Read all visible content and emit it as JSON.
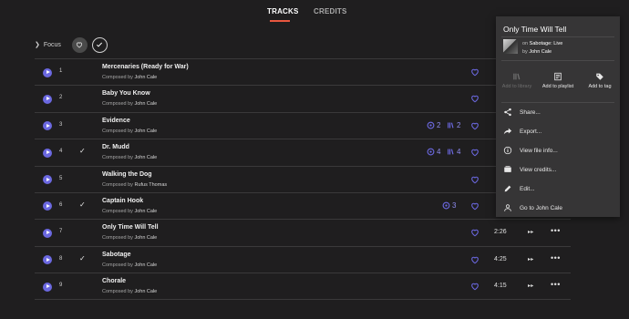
{
  "tabs": [
    {
      "label": "TRACKS",
      "active": true
    },
    {
      "label": "CREDITS",
      "active": false
    }
  ],
  "filters": {
    "focus_label": "Focus"
  },
  "tracks": [
    {
      "number": "1",
      "title": "Mercenaries (Ready for War)",
      "composed_prefix": "Composed by",
      "composer": "John Cale",
      "owned": false,
      "duration": "",
      "stats": []
    },
    {
      "number": "2",
      "title": "Baby You Know",
      "composed_prefix": "Composed by",
      "composer": "John Cale",
      "owned": false,
      "duration": "",
      "stats": []
    },
    {
      "number": "3",
      "title": "Evidence",
      "composed_prefix": "Composed by",
      "composer": "John Cale",
      "owned": false,
      "duration": "",
      "stats": [
        {
          "icon": "versions-icon",
          "value": "2"
        },
        {
          "icon": "library-icon",
          "value": "2"
        }
      ]
    },
    {
      "number": "4",
      "title": "Dr. Mudd",
      "composed_prefix": "Composed by",
      "composer": "John Cale",
      "owned": true,
      "duration": "",
      "stats": [
        {
          "icon": "versions-icon",
          "value": "4"
        },
        {
          "icon": "library-icon",
          "value": "4"
        }
      ]
    },
    {
      "number": "5",
      "title": "Walking the Dog",
      "composed_prefix": "Composed by",
      "composer": "Rufus Thomas",
      "owned": false,
      "duration": "",
      "stats": []
    },
    {
      "number": "6",
      "title": "Captain Hook",
      "composed_prefix": "Composed by",
      "composer": "John Cale",
      "owned": true,
      "duration": "",
      "stats": [
        {
          "icon": "versions-icon",
          "value": "3"
        }
      ]
    },
    {
      "number": "7",
      "title": "Only Time Will Tell",
      "composed_prefix": "Composed by",
      "composer": "John Cale",
      "owned": false,
      "duration": "2:26",
      "stats": []
    },
    {
      "number": "8",
      "title": "Sabotage",
      "composed_prefix": "Composed by",
      "composer": "John Cale",
      "owned": true,
      "duration": "4:25",
      "stats": []
    },
    {
      "number": "9",
      "title": "Chorale",
      "composed_prefix": "Composed by",
      "composer": "John Cale",
      "owned": false,
      "duration": "4:15",
      "stats": []
    }
  ],
  "row_controls": {
    "next_label": "▸ ▸",
    "more_label": "•••"
  },
  "context_menu": {
    "title": "Only Time Will Tell",
    "album_prefix": "on",
    "album_name": "Sabotage: Live",
    "artist_prefix": "by",
    "artist_name": "John Cale",
    "actions": [
      {
        "label": "Add to library",
        "enabled": false,
        "icon": "library-add-icon"
      },
      {
        "label": "Add to playlist",
        "enabled": true,
        "icon": "playlist-add-icon"
      },
      {
        "label": "Add to tag",
        "enabled": true,
        "icon": "tag-icon"
      }
    ],
    "items": [
      {
        "label": "Share...",
        "icon": "share-icon"
      },
      {
        "label": "Export...",
        "icon": "export-icon"
      },
      {
        "label": "View file info...",
        "icon": "info-icon"
      },
      {
        "label": "View credits...",
        "icon": "credits-icon"
      },
      {
        "label": "Edit...",
        "icon": "edit-icon"
      },
      {
        "label": "Go to John Cale",
        "icon": "person-icon"
      }
    ]
  },
  "colors": {
    "background": "#1f1e1f",
    "accent": "#6b68e0",
    "active_tab_underline": "#e8573f",
    "menu_background": "#363536"
  }
}
